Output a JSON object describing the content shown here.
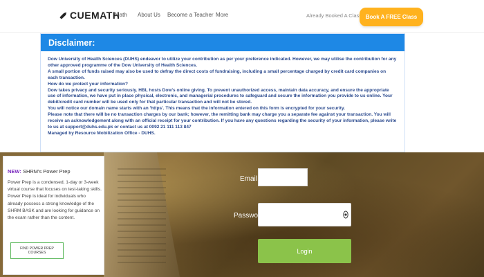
{
  "nav": {
    "brand": "CUEMATH",
    "links": [
      "Math",
      "About Us",
      "Become a Teacher",
      "More"
    ],
    "already_booked": "Already Booked A Class?",
    "cta": "Book A FREE Class"
  },
  "disclaimer": {
    "title": "Disclaimer:",
    "paragraphs": [
      "Dow University of Health Sciences (DUHS) endeavor to utilize your contribution as per your preference indicated. However, we may utilise the contribution for any other approved programme of the Dow University of Health Sciences.",
      "A small portion of funds raised may also be used to defray the direct costs of fundraising, including a small percentage charged by credit card companies on each transaction.",
      "How do we protect your information?",
      "Dow takes privacy and security seriously. HBL hosts Dow's online giving. To prevent unauthorized access, maintain data accuracy, and ensure the appropriate use of information, we have put in place physical, electronic, and managerial procedures to safeguard and secure the information you provide to us online. Your debit/credit card number will be used only for that particular transaction and will not be stored.",
      "You will notice our domain name starts with an 'https'. This means that the information entered on this form is encrypted for your security.",
      "Please note that there will be no transaction charges by our bank; however, the remitting bank may charge you a separate fee against your transaction. You will receive an acknowledgement along with an official receipt for your contribution. If you have any questions regarding the security of your information, please write to us at support@duhs.edu.pk or contact us at 0092 21 111 113 847",
      "Managed by Resource Mobilization Office - DUHS."
    ]
  },
  "login_form": {
    "email_label": "Email",
    "email_value": "",
    "password_label": "Password",
    "password_value": "",
    "login_button": "Login"
  },
  "ad": {
    "new_tag": "NEW:",
    "title": " SHRM's Power Prep",
    "body": "Power Prep is a condensed, 1-day or 3-week virtual course that focuses on test-taking skills. Power Prep is ideal for individuals who already possess a strong knowledge of the SHRM BASK and are looking for guidance on the exam rather than the content.",
    "button": "FIND POWER PREP COURSES"
  },
  "colors": {
    "cta": "#ffb21e",
    "disclaimer_header": "#1e88e5",
    "disclaimer_text": "#2b4a8e",
    "login_button": "#8bc34a",
    "ad_new": "#7b2bbf"
  },
  "icons": [
    "rocket-icon",
    "eye-icon"
  ]
}
